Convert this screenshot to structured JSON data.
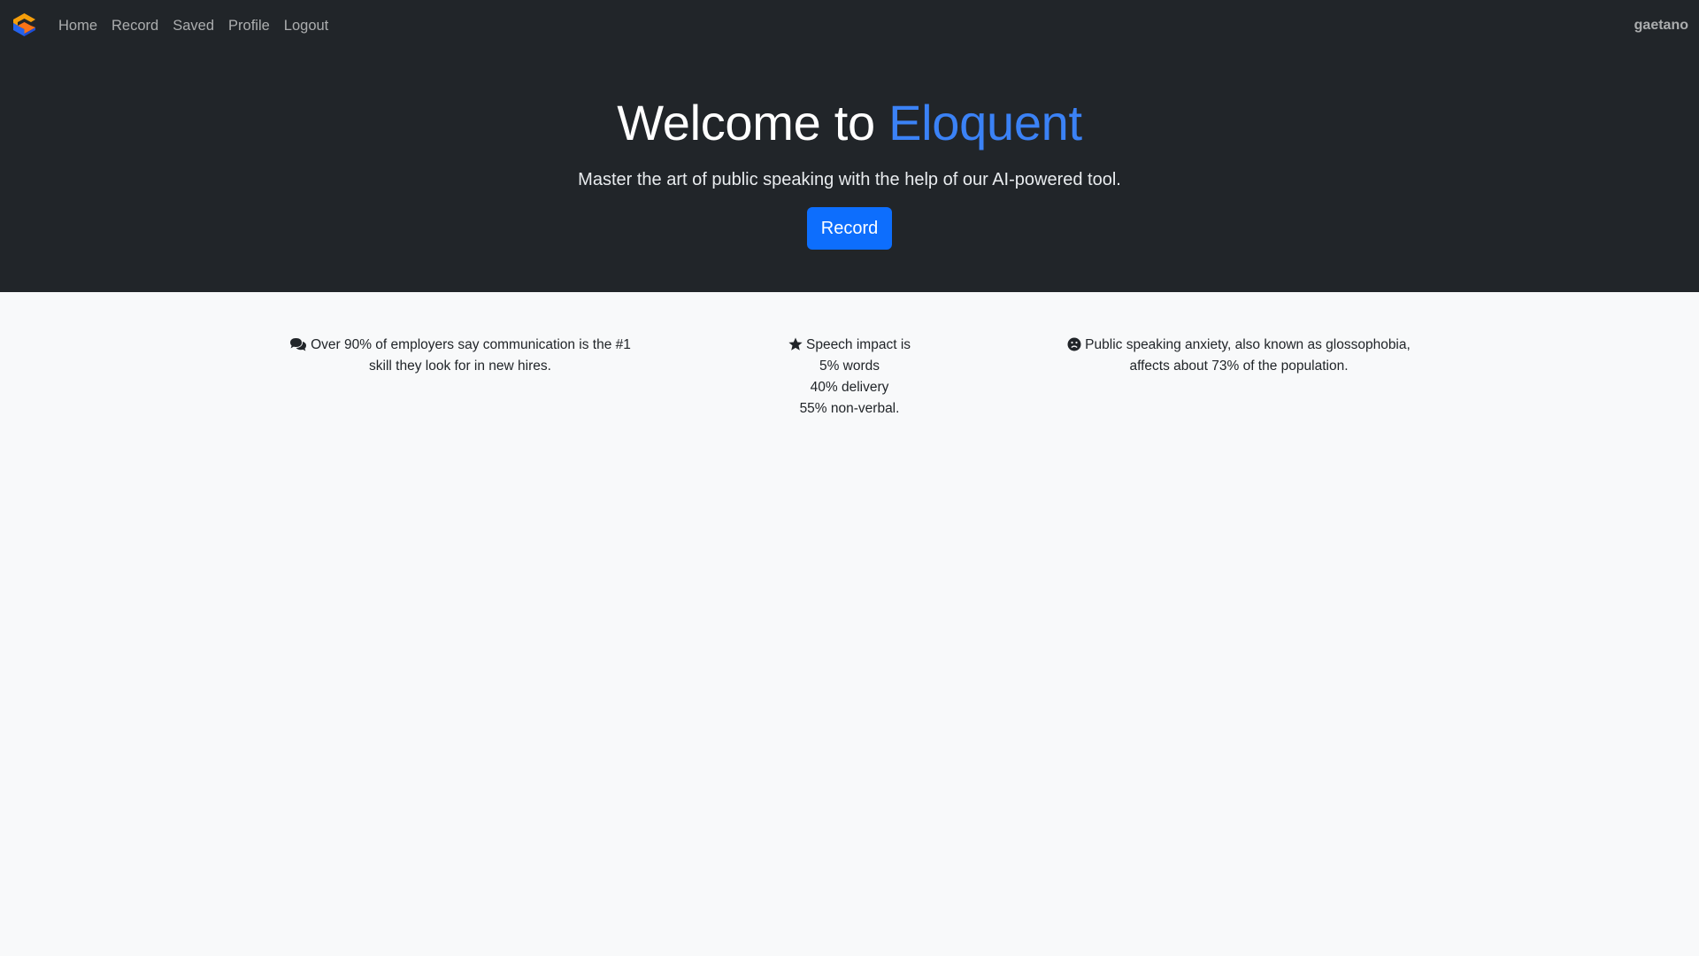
{
  "nav": {
    "brand_icon": "eloquent-logo-icon",
    "links": [
      "Home",
      "Record",
      "Saved",
      "Profile",
      "Logout"
    ],
    "username": "gaetano"
  },
  "hero": {
    "title_prefix": "Welcome to ",
    "title_accent": "Eloquent",
    "subtitle": "Master the art of public speaking with the help of our AI-powered tool.",
    "record_button": "Record",
    "accent_color": "#3b82f6",
    "button_color": "#0d6efd",
    "background_color": "#212529"
  },
  "facts": [
    {
      "icon": "comments-icon",
      "lines": [
        "Over 90% of employers say communication is the #1",
        "skill they look for in new hires."
      ]
    },
    {
      "icon": "star-icon",
      "lines": [
        "Speech impact is",
        "5% words",
        "40% delivery",
        "55% non-verbal."
      ]
    },
    {
      "icon": "frown-icon",
      "lines": [
        "Public speaking anxiety, also known as glossophobia,",
        "affects about 73% of the population."
      ]
    }
  ]
}
